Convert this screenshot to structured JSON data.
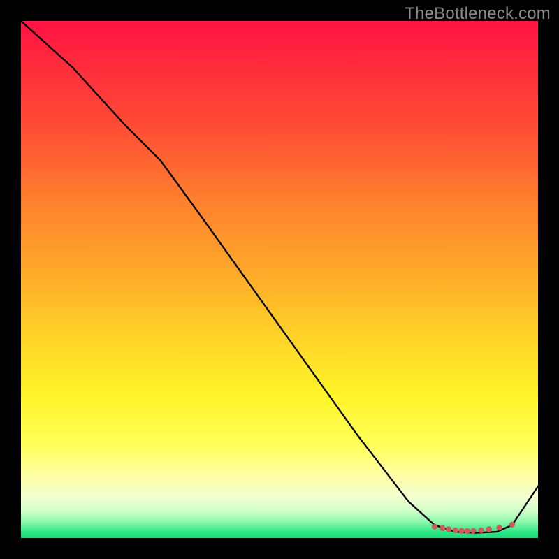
{
  "watermark": "TheBottleneck.com",
  "chart_data": {
    "type": "line",
    "title": "",
    "xlabel": "",
    "ylabel": "",
    "xlim": [
      0,
      100
    ],
    "ylim": [
      0,
      100
    ],
    "series": [
      {
        "name": "bottleneck-curve",
        "x": [
          0,
          10,
          20,
          27,
          35,
          45,
          55,
          65,
          75,
          80,
          84,
          88,
          92,
          95,
          100
        ],
        "y": [
          100,
          91,
          80,
          73,
          62,
          48,
          34,
          20,
          7,
          2.5,
          1.2,
          1.0,
          1.2,
          2.5,
          10
        ]
      }
    ],
    "markers": {
      "name": "trough-markers",
      "x": [
        80,
        81.5,
        82.7,
        84,
        85.2,
        86.3,
        87.5,
        89,
        90.5,
        92.5,
        95
      ],
      "y": [
        2.2,
        1.9,
        1.7,
        1.5,
        1.4,
        1.35,
        1.4,
        1.5,
        1.7,
        2.0,
        2.6
      ]
    },
    "background_gradient": {
      "top": "#ff1243",
      "mid_upper": "#ffa12a",
      "mid_lower": "#fff427",
      "bottom": "#1ddc7a"
    }
  }
}
